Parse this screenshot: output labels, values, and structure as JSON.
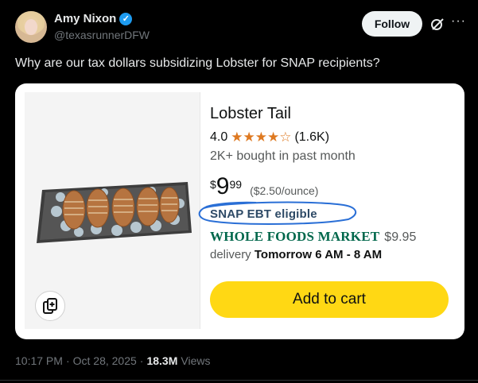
{
  "user": {
    "name": "Amy Nixon",
    "handle": "@texasrunnerDFW",
    "verified_mark": "✓",
    "follow_label": "Follow"
  },
  "icons": {
    "grok": "grok-icon",
    "more": "···",
    "copy": "copy-icon"
  },
  "tweet": {
    "text": "Why are our tax dollars subsidizing Lobster for SNAP recipients?",
    "time": "10:17 PM",
    "dot1": "·",
    "date": "Oct 28, 2025",
    "dot2": "·",
    "views": "18.3M",
    "views_label": "Views"
  },
  "product": {
    "title": "Lobster Tail",
    "rating": "4.0",
    "stars_text": "★★★★☆",
    "rating_value": 4.0,
    "review_count": "(1.6K)",
    "bought": "2K+ bought in past month",
    "currency": "$",
    "price_whole": "9",
    "price_cents": "99",
    "unit_price": "($2.50/ounce)",
    "snap": "SNAP EBT eligible",
    "store": "WHOLE FOODS MARKET",
    "store_price": "$9.95",
    "delivery_label": "delivery",
    "delivery_time": "Tomorrow 6 AM - 8 AM",
    "cart_label": "Add to cart"
  },
  "colors": {
    "accent_blue": "#1d9bf0",
    "star_orange": "#de7921",
    "cart_yellow": "#ffd814",
    "whole_foods_green": "#00674b",
    "snap_circle": "#2a6fd6"
  }
}
